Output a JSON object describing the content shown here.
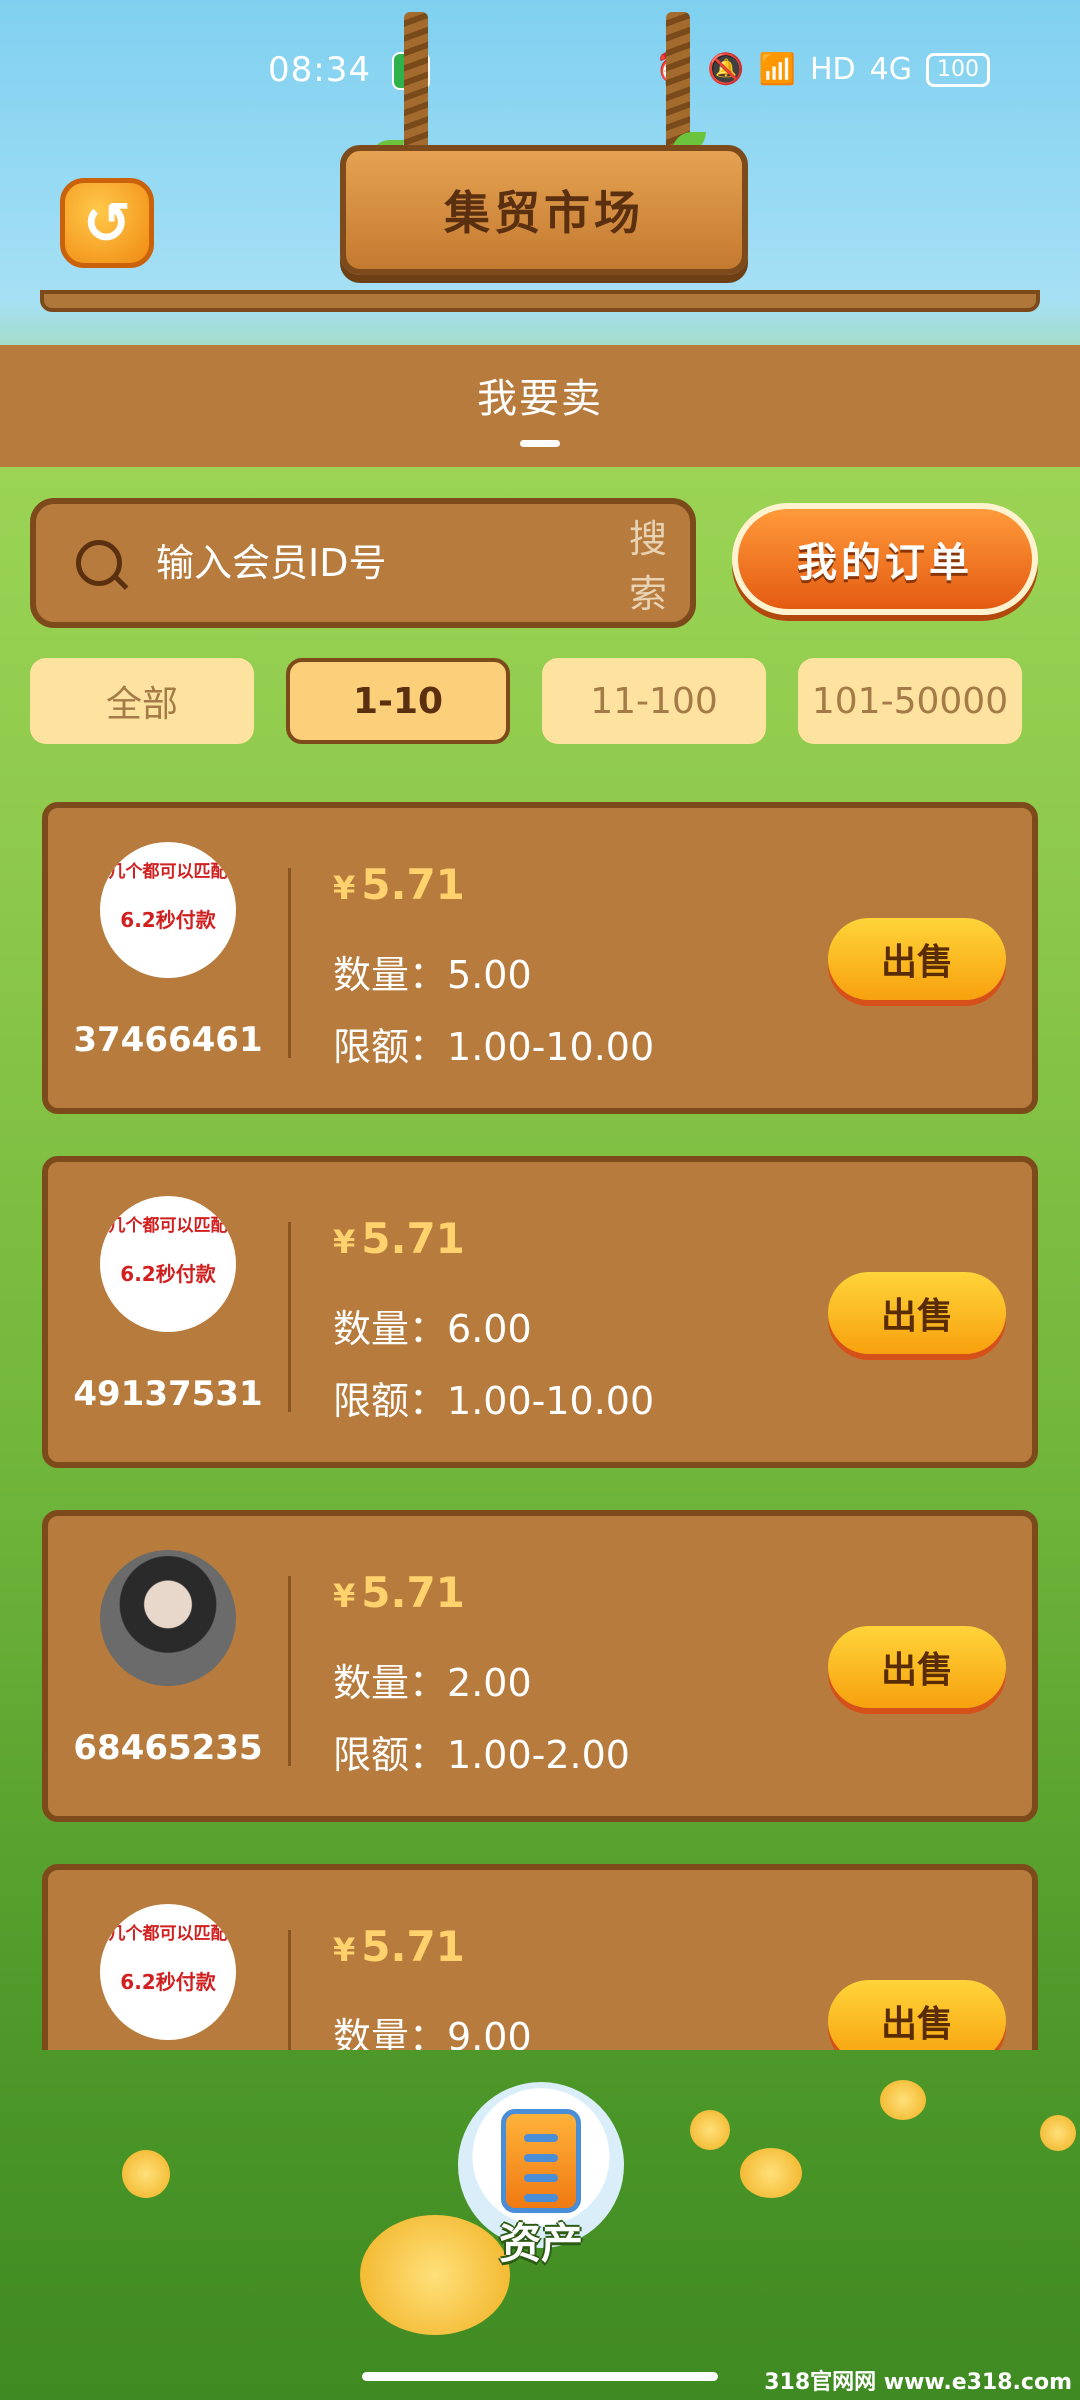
{
  "status_bar": {
    "time": "08:34",
    "battery": "100",
    "network": "4G",
    "hd": "HD"
  },
  "header": {
    "title": "集贸市场",
    "back_icon": "refresh-back-icon"
  },
  "tab": {
    "label": "我要卖"
  },
  "search": {
    "placeholder": "输入会员ID号",
    "button_label": "搜索",
    "my_orders_label": "我的订单"
  },
  "filters": [
    {
      "label": "全部",
      "active": false
    },
    {
      "label": "1-10",
      "active": true
    },
    {
      "label": "11-100",
      "active": false
    },
    {
      "label": "101-50000",
      "active": false
    }
  ],
  "listings": [
    {
      "avatar_text_1": "几个都可以匹配",
      "avatar_text_2": "6.2秒付款",
      "user_id": "37466461",
      "currency": "¥",
      "price": "5.71",
      "qty_label": "数量：",
      "qty": "5.00",
      "limit_label": "限额：",
      "limit": "1.00-10.00",
      "sell_label": "出售"
    },
    {
      "avatar_text_1": "几个都可以匹配",
      "avatar_text_2": "6.2秒付款",
      "user_id": "49137531",
      "currency": "¥",
      "price": "5.71",
      "qty_label": "数量：",
      "qty": "6.00",
      "limit_label": "限额：",
      "limit": "1.00-10.00",
      "sell_label": "出售"
    },
    {
      "avatar_text_1": "",
      "avatar_text_2": "",
      "user_id": "68465235",
      "currency": "¥",
      "price": "5.71",
      "qty_label": "数量：",
      "qty": "2.00",
      "limit_label": "限额：",
      "limit": "1.00-2.00",
      "sell_label": "出售"
    },
    {
      "avatar_text_1": "几个都可以匹配",
      "avatar_text_2": "6.2秒付款",
      "user_id": "",
      "currency": "¥",
      "price": "5.71",
      "qty_label": "数量：",
      "qty": "9.00",
      "limit_label": "",
      "limit": "",
      "sell_label": "出售"
    }
  ],
  "bottom": {
    "assets_label": "资产"
  },
  "watermark": "318官网网 www.e318.com"
}
